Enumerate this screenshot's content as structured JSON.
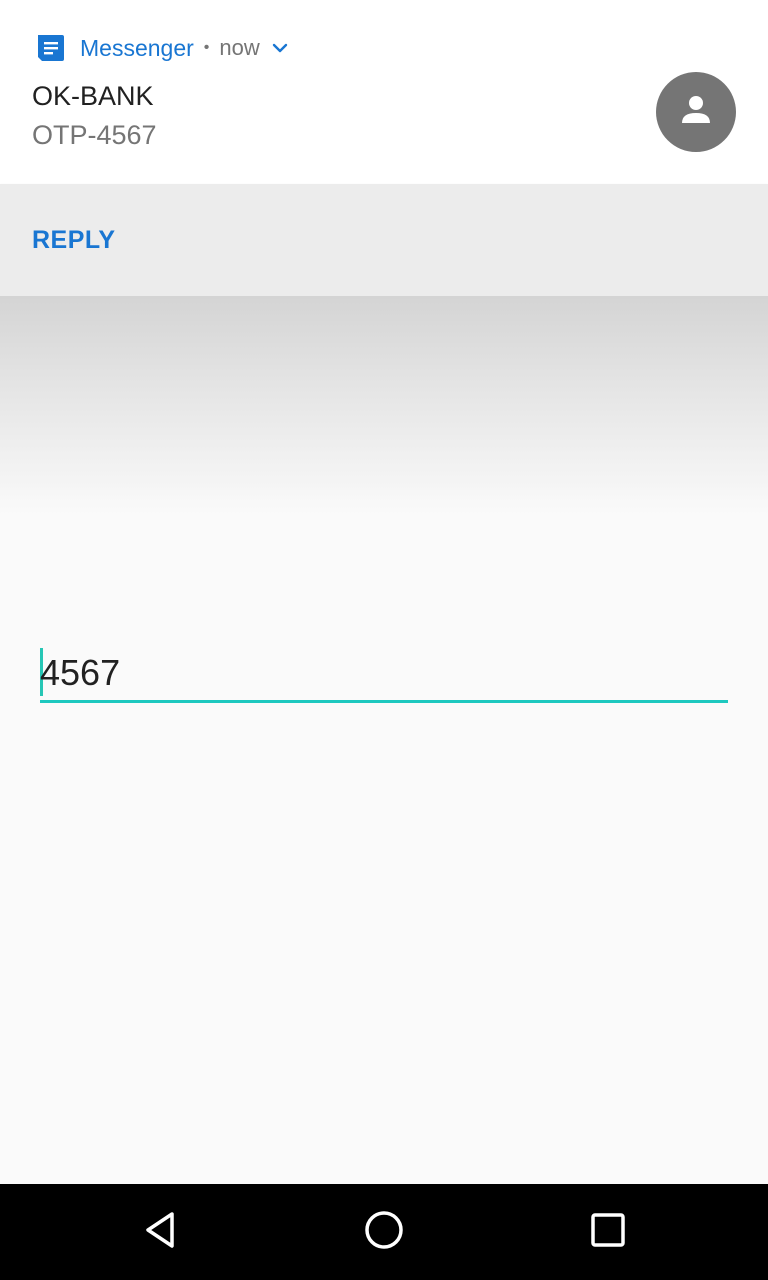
{
  "notification": {
    "app_name": "Messenger",
    "separator": "•",
    "time": "now",
    "title": "OK-BANK",
    "text": "OTP-4567",
    "app_icon": "messenger-icon",
    "expand_icon": "chevron-down-icon",
    "avatar_icon": "person-icon"
  },
  "actions": {
    "reply_label": "REPLY"
  },
  "reply_input": {
    "value": "4567"
  },
  "navbar": {
    "back_icon": "back-icon",
    "home_icon": "home-icon",
    "recents_icon": "recents-icon"
  },
  "colors": {
    "accent": "#1976d2",
    "input_underline": "#1ec8bf",
    "avatar_bg": "#757575"
  }
}
